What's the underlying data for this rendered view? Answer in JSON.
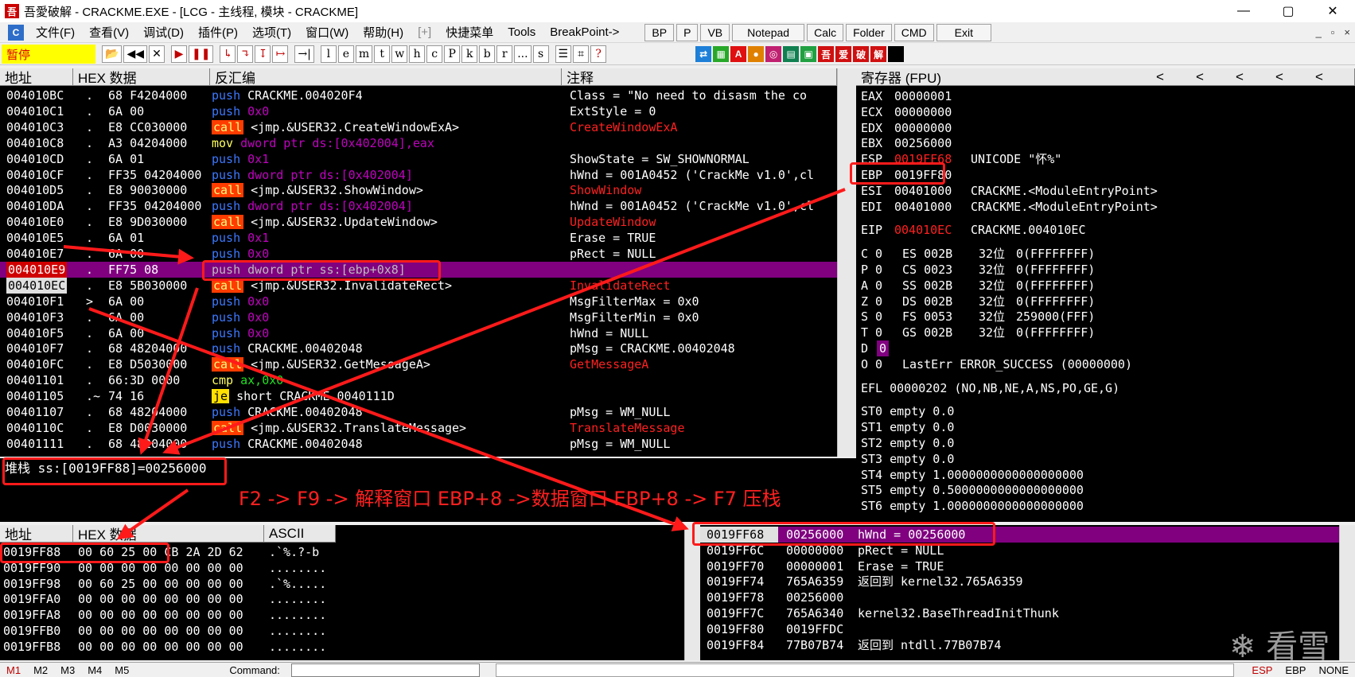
{
  "window": {
    "title": "吾愛破解 - CRACKME.EXE - [LCG - 主线程, 模块 - CRACKME]",
    "app_icon": "吾"
  },
  "menubar": {
    "icon_letter": "C",
    "items": [
      "文件(F)",
      "查看(V)",
      "调试(D)",
      "插件(P)",
      "选项(T)",
      "窗口(W)",
      "帮助(H)",
      "[+]",
      "快捷菜单",
      "Tools",
      "BreakPoint->"
    ],
    "buttons": [
      "BP",
      "P",
      "VB",
      "Notepad",
      "Calc",
      "Folder",
      "CMD",
      "Exit"
    ],
    "mini": [
      "_",
      "▫",
      "×"
    ]
  },
  "toolbar": {
    "status": "暂停",
    "buttons": [
      "📂",
      "◀◀",
      "✕",
      "▶",
      "❚❚",
      "↳",
      "↴",
      "↧",
      "↦",
      "→|",
      "l",
      "e",
      "m",
      "t",
      "w",
      "h",
      "c",
      "P",
      "k",
      "b",
      "r",
      "...",
      "s",
      "☰",
      "⌗",
      "?"
    ],
    "color_icons": [
      "⇄",
      "▦",
      "A",
      "●",
      "◎",
      "▤",
      "▣",
      "吾",
      "爱",
      "破",
      "解",
      " "
    ]
  },
  "disasm": {
    "headers": [
      "地址",
      "HEX 数据",
      "反汇编",
      "注释"
    ],
    "rows": [
      {
        "addr": "004010BC",
        "m": ".",
        "hex": "68 F4204000",
        "op": "push",
        "args": "CRACKME.004020F4",
        "cm": "Class = \"No need to disasm the co"
      },
      {
        "addr": "004010C1",
        "m": ".",
        "hex": "6A 00",
        "op": "push",
        "args": "0x0",
        "cm": "ExtStyle = 0"
      },
      {
        "addr": "004010C3",
        "m": ".",
        "hex": "E8 CC030000",
        "op": "call",
        "args": "<jmp.&USER32.CreateWindowExA>",
        "cm": "CreateWindowExA"
      },
      {
        "addr": "004010C8",
        "m": ".",
        "hex": "A3 04204000",
        "op": "mov",
        "args": "dword ptr ds:[0x402004],eax",
        "cm": ""
      },
      {
        "addr": "004010CD",
        "m": ".",
        "hex": "6A 01",
        "op": "push",
        "args": "0x1",
        "cm": "ShowState = SW_SHOWNORMAL"
      },
      {
        "addr": "004010CF",
        "m": ".",
        "hex": "FF35 04204000",
        "op": "push",
        "args": "dword ptr ds:[0x402004]",
        "cm": "hWnd = 001A0452 ('CrackMe v1.0',cl"
      },
      {
        "addr": "004010D5",
        "m": ".",
        "hex": "E8 90030000",
        "op": "call",
        "args": "<jmp.&USER32.ShowWindow>",
        "cm": "ShowWindow"
      },
      {
        "addr": "004010DA",
        "m": ".",
        "hex": "FF35 04204000",
        "op": "push",
        "args": "dword ptr ds:[0x402004]",
        "cm": "hWnd = 001A0452 ('CrackMe v1.0',cl"
      },
      {
        "addr": "004010E0",
        "m": ".",
        "hex": "E8 9D030000",
        "op": "call",
        "args": "<jmp.&USER32.UpdateWindow>",
        "cm": "UpdateWindow"
      },
      {
        "addr": "004010E5",
        "m": ".",
        "hex": "6A 01",
        "op": "push",
        "args": "0x1",
        "cm": "Erase = TRUE"
      },
      {
        "addr": "004010E7",
        "m": ".",
        "hex": "6A 00",
        "op": "push",
        "args": "0x0",
        "cm": "pRect = NULL"
      },
      {
        "addr": "004010E9",
        "m": ".",
        "hex": "FF75 08",
        "op": "push",
        "args": "dword ptr ss:[ebp+0x8]",
        "cm": ""
      },
      {
        "addr": "004010EC",
        "m": ".",
        "hex": "E8 5B030000",
        "op": "call",
        "args": "<jmp.&USER32.InvalidateRect>",
        "cm": "InvalidateRect"
      },
      {
        "addr": "004010F1",
        "m": ">",
        "hex": "6A 00",
        "op": "push",
        "args": "0x0",
        "cm": "MsgFilterMax = 0x0"
      },
      {
        "addr": "004010F3",
        "m": ".",
        "hex": "6A 00",
        "op": "push",
        "args": "0x0",
        "cm": "MsgFilterMin = 0x0"
      },
      {
        "addr": "004010F5",
        "m": ".",
        "hex": "6A 00",
        "op": "push",
        "args": "0x0",
        "cm": "hWnd = NULL"
      },
      {
        "addr": "004010F7",
        "m": ".",
        "hex": "68 48204000",
        "op": "push",
        "args": "CRACKME.00402048",
        "cm": "pMsg = CRACKME.00402048"
      },
      {
        "addr": "004010FC",
        "m": ".",
        "hex": "E8 D5030000",
        "op": "call",
        "args": "<jmp.&USER32.GetMessageA>",
        "cm": "GetMessageA"
      },
      {
        "addr": "00401101",
        "m": ".",
        "hex": "66:3D 0000",
        "op": "cmp",
        "args": "ax,0x0",
        "cm": ""
      },
      {
        "addr": "00401105",
        "m": ".~",
        "hex": "74 16",
        "op": "je",
        "args": "short CRACKME.0040111D",
        "cm": ""
      },
      {
        "addr": "00401107",
        "m": ".",
        "hex": "68 48204000",
        "op": "push",
        "args": "CRACKME.00402048",
        "cm": "pMsg = WM_NULL"
      },
      {
        "addr": "0040110C",
        "m": ".",
        "hex": "E8 D0030000",
        "op": "call",
        "args": "<jmp.&USER32.TranslateMessage>",
        "cm": "TranslateMessage"
      },
      {
        "addr": "00401111",
        "m": ".",
        "hex": "68 48204000",
        "op": "push",
        "args": "CRACKME.00402048",
        "cm": "pMsg = WM_NULL"
      }
    ]
  },
  "info": {
    "text": "堆栈 ss:[0019FF88]=00256000"
  },
  "registers": {
    "header": "寄存器 (FPU)",
    "header_arrows": [
      "<",
      "<",
      "<",
      "<",
      "<"
    ],
    "general": [
      {
        "name": "EAX",
        "value": "00000001",
        "extra": ""
      },
      {
        "name": "ECX",
        "value": "00000000",
        "extra": ""
      },
      {
        "name": "EDX",
        "value": "00000000",
        "extra": ""
      },
      {
        "name": "EBX",
        "value": "00256000",
        "extra": ""
      },
      {
        "name": "ESP",
        "value": "0019FF68",
        "extra": "UNICODE \"怀%\""
      },
      {
        "name": "EBP",
        "value": "0019FF80",
        "extra": ""
      },
      {
        "name": "ESI",
        "value": "00401000",
        "extra": "CRACKME.<ModuleEntryPoint>"
      },
      {
        "name": "EDI",
        "value": "00401000",
        "extra": "CRACKME.<ModuleEntryPoint>"
      }
    ],
    "eip": {
      "name": "EIP",
      "value": "004010EC",
      "extra": "CRACKME.004010EC"
    },
    "segments": [
      {
        "flag": "C 0",
        "seg": "ES 002B",
        "bits": "32位",
        "base": "0(FFFFFFFF)"
      },
      {
        "flag": "P 0",
        "seg": "CS 0023",
        "bits": "32位",
        "base": "0(FFFFFFFF)"
      },
      {
        "flag": "A 0",
        "seg": "SS 002B",
        "bits": "32位",
        "base": "0(FFFFFFFF)"
      },
      {
        "flag": "Z 0",
        "seg": "DS 002B",
        "bits": "32位",
        "base": "0(FFFFFFFF)"
      },
      {
        "flag": "S 0",
        "seg": "FS 0053",
        "bits": "32位",
        "base": "259000(FFF)"
      },
      {
        "flag": "T 0",
        "seg": "GS 002B",
        "bits": "32位",
        "base": "0(FFFFFFFF)"
      }
    ],
    "d_flag": "D",
    "d_value": "0",
    "o_flag": "O 0",
    "lasterr": "LastErr ERROR_SUCCESS (00000000)",
    "efl": "EFL 00000202 (NO,NB,NE,A,NS,PO,GE,G)",
    "fpu": [
      "ST0 empty 0.0",
      "ST1 empty 0.0",
      "ST2 empty 0.0",
      "ST3 empty 0.0",
      "ST4 empty 1.0000000000000000000",
      "ST5 empty 0.5000000000000000000",
      "ST6 empty 1.0000000000000000000"
    ]
  },
  "dump": {
    "headers": [
      "地址",
      "HEX 数据",
      "ASCII"
    ],
    "rows": [
      {
        "addr": "0019FF88",
        "hex": "00 60 25 00 CB 2A 2D 62",
        "ascii": ".`%.?-b"
      },
      {
        "addr": "0019FF90",
        "hex": "00 00 00 00 00 00 00 00",
        "ascii": "........"
      },
      {
        "addr": "0019FF98",
        "hex": "00 60 25 00 00 00 00 00",
        "ascii": ".`%....."
      },
      {
        "addr": "0019FFA0",
        "hex": "00 00 00 00 00 00 00 00",
        "ascii": "........"
      },
      {
        "addr": "0019FFA8",
        "hex": "00 00 00 00 00 00 00 00",
        "ascii": "........"
      },
      {
        "addr": "0019FFB0",
        "hex": "00 00 00 00 00 00 00 00",
        "ascii": "........"
      },
      {
        "addr": "0019FFB8",
        "hex": "00 00 00 00 00 00 00 00",
        "ascii": "........"
      }
    ]
  },
  "stack": {
    "rows": [
      {
        "addr": "0019FF68",
        "val": "00256000",
        "cm": "hWnd = 00256000"
      },
      {
        "addr": "0019FF6C",
        "val": "00000000",
        "cm": "pRect = NULL"
      },
      {
        "addr": "0019FF70",
        "val": "00000001",
        "cm": "Erase = TRUE"
      },
      {
        "addr": "0019FF74",
        "val": "765A6359",
        "cm": "返回到 kernel32.765A6359"
      },
      {
        "addr": "0019FF78",
        "val": "00256000",
        "cm": ""
      },
      {
        "addr": "0019FF7C",
        "val": "765A6340",
        "cm": "kernel32.BaseThreadInitThunk"
      },
      {
        "addr": "0019FF80",
        "val": "0019FFDC",
        "cm": ""
      },
      {
        "addr": "0019FF84",
        "val": "77B07B74",
        "cm": "返回到 ntdll.77B07B74"
      }
    ]
  },
  "annotation": "F2 -> F9 -> 解释窗口 EBP+8 ->数据窗口 EBP+8 -> F7 压栈",
  "statusbar": {
    "marks": [
      "M1",
      "M2",
      "M3",
      "M4",
      "M5"
    ],
    "command_label": "Command:",
    "right": [
      "ESP",
      "EBP",
      "NONE"
    ]
  },
  "watermark": "❄ 看雪"
}
